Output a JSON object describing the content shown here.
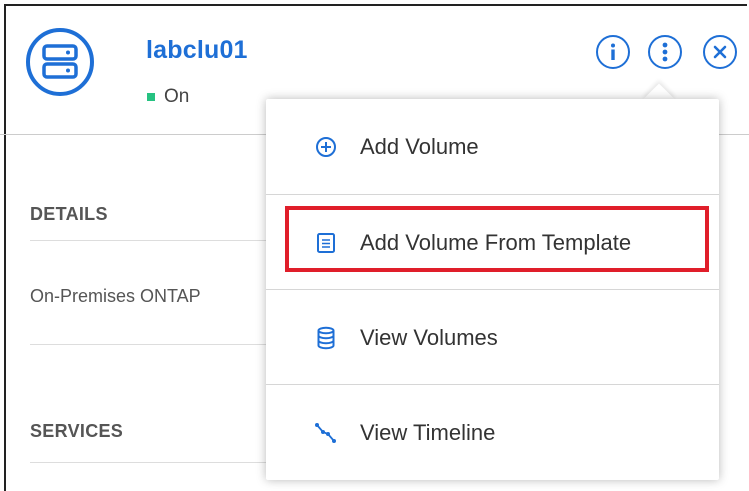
{
  "header": {
    "cluster_name": "labclu01",
    "status": "On",
    "status_color": "#26c281",
    "accent_color": "#1e6fd6",
    "icons": [
      "storage-server-icon",
      "info-icon",
      "more-options-icon",
      "close-icon"
    ]
  },
  "details": {
    "title": "DETAILS",
    "type_value": "On-Premises ONTAP"
  },
  "services": {
    "title": "SERVICES"
  },
  "menu": {
    "items": [
      {
        "label": "Add Volume",
        "icon": "add-circle-icon"
      },
      {
        "label": "Add Volume From Template",
        "icon": "template-document-icon",
        "highlighted": true
      },
      {
        "label": "View Volumes",
        "icon": "database-icon"
      },
      {
        "label": "View Timeline",
        "icon": "timeline-icon"
      }
    ],
    "highlight_color": "#e01e2a"
  }
}
